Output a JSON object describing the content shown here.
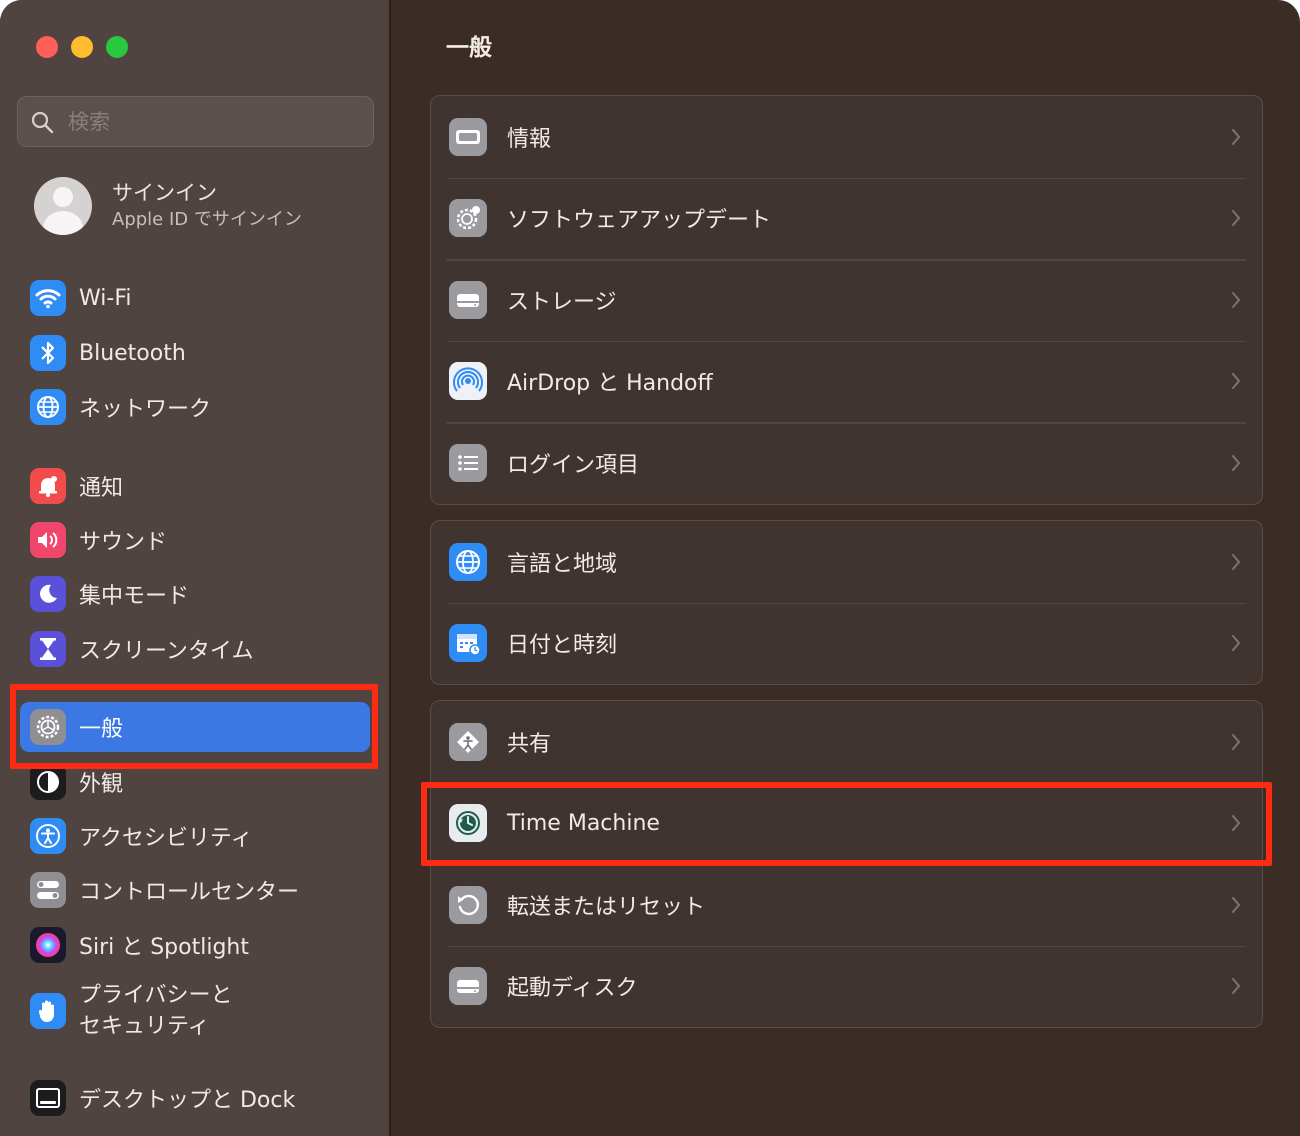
{
  "window": {
    "title": "一般"
  },
  "search": {
    "placeholder": "検索"
  },
  "account": {
    "title": "サインイン",
    "subtitle": "Apple ID でサインイン"
  },
  "sidebar": {
    "items": [
      {
        "label": "Wi-Fi",
        "icon": "wifi-icon"
      },
      {
        "label": "Bluetooth",
        "icon": "bluetooth-icon"
      },
      {
        "label": "ネットワーク",
        "icon": "globe-network-icon"
      },
      {
        "label": "通知",
        "icon": "bell-icon"
      },
      {
        "label": "サウンド",
        "icon": "speaker-icon"
      },
      {
        "label": "集中モード",
        "icon": "moon-icon"
      },
      {
        "label": "スクリーンタイム",
        "icon": "hourglass-icon"
      },
      {
        "label": "一般",
        "icon": "gear-icon",
        "selected": true
      },
      {
        "label": "外観",
        "icon": "appearance-icon"
      },
      {
        "label": "アクセシビリティ",
        "icon": "accessibility-icon"
      },
      {
        "label": "コントロールセンター",
        "icon": "toggles-icon"
      },
      {
        "label": "Siri と Spotlight",
        "icon": "siri-icon"
      },
      {
        "label": "プライバシーと\nセキュリティ",
        "icon": "hand-icon"
      },
      {
        "label": "デスクトップと Dock",
        "icon": "dock-icon"
      }
    ]
  },
  "main": {
    "title": "一般",
    "groups": [
      {
        "rows": [
          {
            "label": "情報",
            "icon": "info-laptop-icon"
          },
          {
            "label": "ソフトウェアアップデート",
            "icon": "software-update-gear-icon"
          },
          {
            "label": "ストレージ",
            "icon": "storage-drive-icon"
          },
          {
            "label": "AirDrop と Handoff",
            "icon": "airdrop-icon"
          },
          {
            "label": "ログイン項目",
            "icon": "list-icon"
          }
        ]
      },
      {
        "rows": [
          {
            "label": "言語と地域",
            "icon": "globe-icon"
          },
          {
            "label": "日付と時刻",
            "icon": "calendar-clock-icon"
          }
        ]
      },
      {
        "rows": [
          {
            "label": "共有",
            "icon": "sharing-icon"
          },
          {
            "label": "Time Machine",
            "icon": "time-machine-icon"
          },
          {
            "label": "転送またはリセット",
            "icon": "reset-icon"
          },
          {
            "label": "起動ディスク",
            "icon": "startup-disk-icon"
          }
        ]
      }
    ]
  },
  "colors": {
    "accent": "#3b78e3",
    "highlight": "#ff2a12",
    "sidebar_bg": "#4f4440",
    "main_bg": "#3b2c26"
  }
}
